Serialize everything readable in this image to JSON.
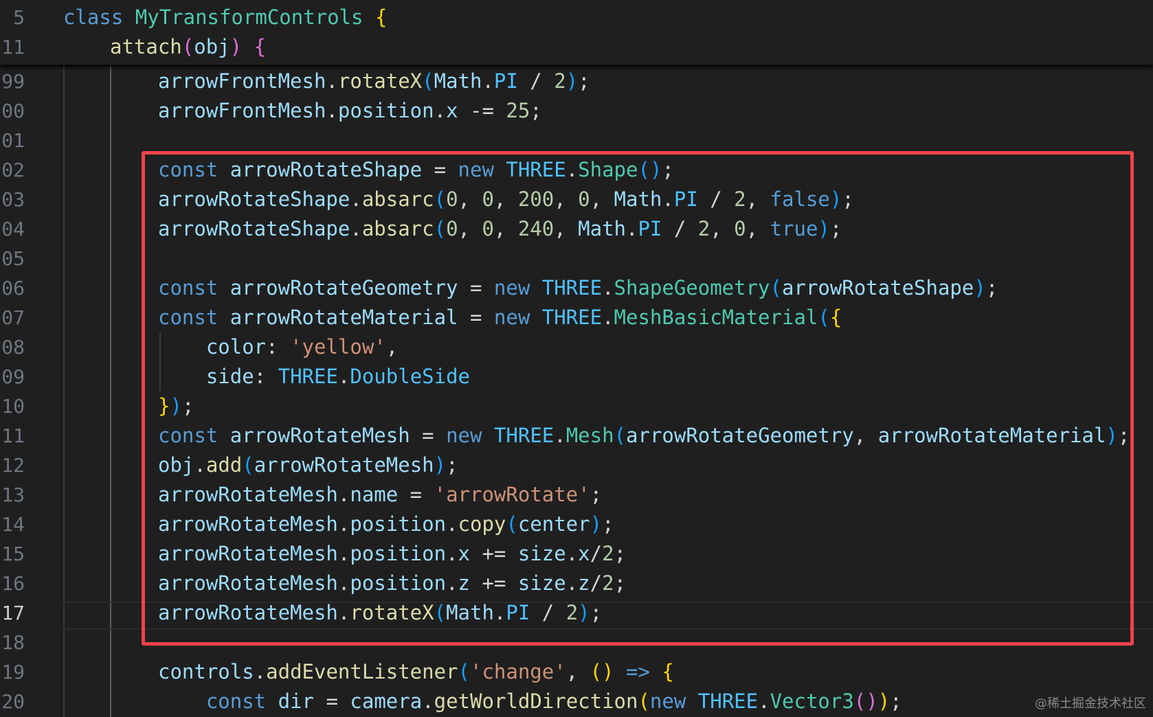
{
  "editor": {
    "theme": {
      "background": "#1f1f1f",
      "highlight_box_color": "#f2434b"
    },
    "sticky_lines": [
      {
        "number": "5",
        "tokens": [
          [
            "kw",
            "class"
          ],
          [
            "op",
            " "
          ],
          [
            "cls",
            "MyTransformControls"
          ],
          [
            "op",
            " "
          ],
          [
            "b1",
            "{"
          ]
        ]
      },
      {
        "number": "11",
        "tokens": [
          [
            "fn",
            "attach"
          ],
          [
            "b2",
            "("
          ],
          [
            "var",
            "obj"
          ],
          [
            "b2",
            ")"
          ],
          [
            "op",
            " "
          ],
          [
            "b2",
            "{"
          ]
        ]
      }
    ],
    "lines": [
      {
        "number": "99",
        "tokens": [
          [
            "var",
            "arrowFrontMesh"
          ],
          [
            "op",
            "."
          ],
          [
            "fn",
            "rotateX"
          ],
          [
            "b3",
            "("
          ],
          [
            "var",
            "Math"
          ],
          [
            "op",
            "."
          ],
          [
            "const",
            "PI"
          ],
          [
            "op",
            " / "
          ],
          [
            "num",
            "2"
          ],
          [
            "b3",
            ")"
          ],
          [
            "op",
            ";"
          ]
        ]
      },
      {
        "number": "00",
        "tokens": [
          [
            "var",
            "arrowFrontMesh"
          ],
          [
            "op",
            "."
          ],
          [
            "var",
            "position"
          ],
          [
            "op",
            "."
          ],
          [
            "var",
            "x"
          ],
          [
            "op",
            " -= "
          ],
          [
            "num",
            "25"
          ],
          [
            "op",
            ";"
          ]
        ]
      },
      {
        "number": "01",
        "tokens": []
      },
      {
        "number": "02",
        "tokens": [
          [
            "kw",
            "const"
          ],
          [
            "op",
            " "
          ],
          [
            "var",
            "arrowRotateShape"
          ],
          [
            "op",
            " = "
          ],
          [
            "kw",
            "new"
          ],
          [
            "op",
            " "
          ],
          [
            "const",
            "THREE"
          ],
          [
            "op",
            "."
          ],
          [
            "cls",
            "Shape"
          ],
          [
            "b3",
            "()"
          ],
          [
            "op",
            ";"
          ]
        ]
      },
      {
        "number": "03",
        "tokens": [
          [
            "var",
            "arrowRotateShape"
          ],
          [
            "op",
            "."
          ],
          [
            "fn",
            "absarc"
          ],
          [
            "b3",
            "("
          ],
          [
            "num",
            "0"
          ],
          [
            "op",
            ", "
          ],
          [
            "num",
            "0"
          ],
          [
            "op",
            ", "
          ],
          [
            "num",
            "200"
          ],
          [
            "op",
            ", "
          ],
          [
            "num",
            "0"
          ],
          [
            "op",
            ", "
          ],
          [
            "var",
            "Math"
          ],
          [
            "op",
            "."
          ],
          [
            "const",
            "PI"
          ],
          [
            "op",
            " / "
          ],
          [
            "num",
            "2"
          ],
          [
            "op",
            ", "
          ],
          [
            "kw",
            "false"
          ],
          [
            "b3",
            ")"
          ],
          [
            "op",
            ";"
          ]
        ]
      },
      {
        "number": "04",
        "tokens": [
          [
            "var",
            "arrowRotateShape"
          ],
          [
            "op",
            "."
          ],
          [
            "fn",
            "absarc"
          ],
          [
            "b3",
            "("
          ],
          [
            "num",
            "0"
          ],
          [
            "op",
            ", "
          ],
          [
            "num",
            "0"
          ],
          [
            "op",
            ", "
          ],
          [
            "num",
            "240"
          ],
          [
            "op",
            ", "
          ],
          [
            "var",
            "Math"
          ],
          [
            "op",
            "."
          ],
          [
            "const",
            "PI"
          ],
          [
            "op",
            " / "
          ],
          [
            "num",
            "2"
          ],
          [
            "op",
            ", "
          ],
          [
            "num",
            "0"
          ],
          [
            "op",
            ", "
          ],
          [
            "kw",
            "true"
          ],
          [
            "b3",
            ")"
          ],
          [
            "op",
            ";"
          ]
        ]
      },
      {
        "number": "05",
        "tokens": []
      },
      {
        "number": "06",
        "tokens": [
          [
            "kw",
            "const"
          ],
          [
            "op",
            " "
          ],
          [
            "var",
            "arrowRotateGeometry"
          ],
          [
            "op",
            " = "
          ],
          [
            "kw",
            "new"
          ],
          [
            "op",
            " "
          ],
          [
            "const",
            "THREE"
          ],
          [
            "op",
            "."
          ],
          [
            "cls",
            "ShapeGeometry"
          ],
          [
            "b3",
            "("
          ],
          [
            "var",
            "arrowRotateShape"
          ],
          [
            "b3",
            ")"
          ],
          [
            "op",
            ";"
          ]
        ]
      },
      {
        "number": "07",
        "tokens": [
          [
            "kw",
            "const"
          ],
          [
            "op",
            " "
          ],
          [
            "var",
            "arrowRotateMaterial"
          ],
          [
            "op",
            " = "
          ],
          [
            "kw",
            "new"
          ],
          [
            "op",
            " "
          ],
          [
            "const",
            "THREE"
          ],
          [
            "op",
            "."
          ],
          [
            "cls",
            "MeshBasicMaterial"
          ],
          [
            "b3",
            "("
          ],
          [
            "b1",
            "{"
          ]
        ]
      },
      {
        "number": "08",
        "tokens": [
          [
            "op",
            "    "
          ],
          [
            "var",
            "color"
          ],
          [
            "op",
            ": "
          ],
          [
            "str",
            "'yellow'"
          ],
          [
            "op",
            ","
          ]
        ]
      },
      {
        "number": "09",
        "tokens": [
          [
            "op",
            "    "
          ],
          [
            "var",
            "side"
          ],
          [
            "op",
            ": "
          ],
          [
            "const",
            "THREE"
          ],
          [
            "op",
            "."
          ],
          [
            "const",
            "DoubleSide"
          ]
        ]
      },
      {
        "number": "10",
        "tokens": [
          [
            "b1",
            "}"
          ],
          [
            "b3",
            ")"
          ],
          [
            "op",
            ";"
          ]
        ]
      },
      {
        "number": "11",
        "tokens": [
          [
            "kw",
            "const"
          ],
          [
            "op",
            " "
          ],
          [
            "var",
            "arrowRotateMesh"
          ],
          [
            "op",
            " = "
          ],
          [
            "kw",
            "new"
          ],
          [
            "op",
            " "
          ],
          [
            "const",
            "THREE"
          ],
          [
            "op",
            "."
          ],
          [
            "cls",
            "Mesh"
          ],
          [
            "b3",
            "("
          ],
          [
            "var",
            "arrowRotateGeometry"
          ],
          [
            "op",
            ", "
          ],
          [
            "var",
            "arrowRotateMaterial"
          ],
          [
            "b3",
            ")"
          ],
          [
            "op",
            ";"
          ]
        ]
      },
      {
        "number": "12",
        "tokens": [
          [
            "var",
            "obj"
          ],
          [
            "op",
            "."
          ],
          [
            "fn",
            "add"
          ],
          [
            "b3",
            "("
          ],
          [
            "var",
            "arrowRotateMesh"
          ],
          [
            "b3",
            ")"
          ],
          [
            "op",
            ";"
          ]
        ]
      },
      {
        "number": "13",
        "tokens": [
          [
            "var",
            "arrowRotateMesh"
          ],
          [
            "op",
            "."
          ],
          [
            "var",
            "name"
          ],
          [
            "op",
            " = "
          ],
          [
            "str",
            "'arrowRotate'"
          ],
          [
            "op",
            ";"
          ]
        ]
      },
      {
        "number": "14",
        "tokens": [
          [
            "var",
            "arrowRotateMesh"
          ],
          [
            "op",
            "."
          ],
          [
            "var",
            "position"
          ],
          [
            "op",
            "."
          ],
          [
            "fn",
            "copy"
          ],
          [
            "b3",
            "("
          ],
          [
            "var",
            "center"
          ],
          [
            "b3",
            ")"
          ],
          [
            "op",
            ";"
          ]
        ]
      },
      {
        "number": "15",
        "tokens": [
          [
            "var",
            "arrowRotateMesh"
          ],
          [
            "op",
            "."
          ],
          [
            "var",
            "position"
          ],
          [
            "op",
            "."
          ],
          [
            "var",
            "x"
          ],
          [
            "op",
            " += "
          ],
          [
            "var",
            "size"
          ],
          [
            "op",
            "."
          ],
          [
            "var",
            "x"
          ],
          [
            "op",
            "/"
          ],
          [
            "num",
            "2"
          ],
          [
            "op",
            ";"
          ]
        ]
      },
      {
        "number": "16",
        "tokens": [
          [
            "var",
            "arrowRotateMesh"
          ],
          [
            "op",
            "."
          ],
          [
            "var",
            "position"
          ],
          [
            "op",
            "."
          ],
          [
            "var",
            "z"
          ],
          [
            "op",
            " += "
          ],
          [
            "var",
            "size"
          ],
          [
            "op",
            "."
          ],
          [
            "var",
            "z"
          ],
          [
            "op",
            "/"
          ],
          [
            "num",
            "2"
          ],
          [
            "op",
            ";"
          ]
        ]
      },
      {
        "number": "17",
        "active": true,
        "tokens": [
          [
            "var",
            "arrowRotateMesh"
          ],
          [
            "op",
            "."
          ],
          [
            "fn",
            "rotateX"
          ],
          [
            "b3",
            "("
          ],
          [
            "var",
            "Math"
          ],
          [
            "op",
            "."
          ],
          [
            "const",
            "PI"
          ],
          [
            "op",
            " / "
          ],
          [
            "num",
            "2"
          ],
          [
            "b3",
            ")"
          ],
          [
            "op",
            ";"
          ]
        ]
      },
      {
        "number": "18",
        "tokens": []
      },
      {
        "number": "19",
        "tokens": [
          [
            "var",
            "controls"
          ],
          [
            "op",
            "."
          ],
          [
            "fn",
            "addEventListener"
          ],
          [
            "b3",
            "("
          ],
          [
            "str",
            "'change'"
          ],
          [
            "op",
            ", "
          ],
          [
            "b1",
            "()"
          ],
          [
            "op",
            " "
          ],
          [
            "kw",
            "=>"
          ],
          [
            "op",
            " "
          ],
          [
            "b1",
            "{"
          ]
        ]
      },
      {
        "number": "20",
        "tokens": [
          [
            "op",
            "    "
          ],
          [
            "kw",
            "const"
          ],
          [
            "op",
            " "
          ],
          [
            "var",
            "dir"
          ],
          [
            "op",
            " = "
          ],
          [
            "var",
            "camera"
          ],
          [
            "op",
            "."
          ],
          [
            "fn",
            "getWorldDirection"
          ],
          [
            "b1",
            "("
          ],
          [
            "kw",
            "new"
          ],
          [
            "op",
            " "
          ],
          [
            "const",
            "THREE"
          ],
          [
            "op",
            "."
          ],
          [
            "cls",
            "Vector3"
          ],
          [
            "b2",
            "()"
          ],
          [
            "b1",
            ")"
          ],
          [
            "op",
            ";"
          ]
        ]
      }
    ]
  },
  "watermark": "@稀土掘金技术社区"
}
